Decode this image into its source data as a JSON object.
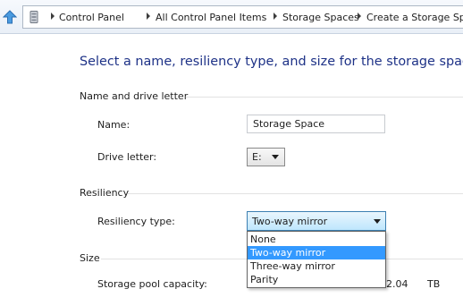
{
  "breadcrumbs": [
    "Control Panel",
    "All Control Panel Items",
    "Storage Spaces",
    "Create a Storage Space"
  ],
  "page": {
    "title": "Select a name, resiliency type, and size for the storage space"
  },
  "sections": {
    "name_drive": "Name and drive letter",
    "resiliency": "Resiliency",
    "size": "Size"
  },
  "fields": {
    "name_label": "Name:",
    "name_value": "Storage Space",
    "drive_label": "Drive letter:",
    "drive_value": "E:",
    "resiliency_label": "Resiliency type:",
    "resiliency_value": "Two-way mirror",
    "resiliency_options": [
      "None",
      "Two-way mirror",
      "Three-way mirror",
      "Parity"
    ],
    "pool_capacity_label": "Storage pool capacity:",
    "pool_capacity_value": "2.04",
    "pool_capacity_unit": "TB"
  },
  "colors": {
    "title": "#1e3287",
    "highlight": "#3399ff",
    "accent_border": "#3c7fb1"
  },
  "icons": {
    "up": "up-arrow-icon",
    "location": "control-panel-icon",
    "crumb_separator": "chevron-right-icon",
    "dropdown": "chevron-down-icon"
  }
}
